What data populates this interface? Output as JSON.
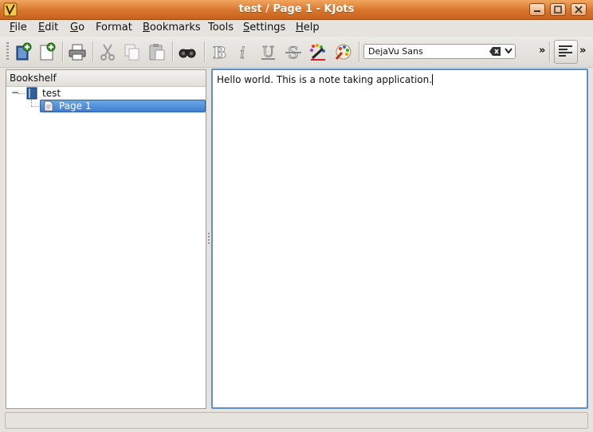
{
  "window": {
    "title": "test / Page 1 - KJots",
    "app_icon": "kjots-pencil-icon",
    "controls": [
      "minimize-icon",
      "maximize-icon",
      "close-icon"
    ]
  },
  "menubar": [
    {
      "label": "File",
      "mnemonic": "F",
      "rest": "ile"
    },
    {
      "label": "Edit",
      "mnemonic": "E",
      "rest": "dit"
    },
    {
      "label": "Go",
      "mnemonic": "G",
      "rest": "o"
    },
    {
      "label": "Format",
      "mnemonic": "",
      "rest": "Format"
    },
    {
      "label": "Bookmarks",
      "mnemonic": "B",
      "rest": "ookmarks"
    },
    {
      "label": "Tools",
      "mnemonic": "",
      "rest": "Tools"
    },
    {
      "label": "Settings",
      "mnemonic": "S",
      "rest": "ettings"
    },
    {
      "label": "Help",
      "mnemonic": "H",
      "rest": "elp"
    }
  ],
  "toolbar": {
    "icons": [
      "new-book-icon",
      "new-page-icon",
      "print-icon",
      "cut-icon",
      "copy-icon",
      "paste-icon",
      "find-icon",
      "bold-icon",
      "italic-icon",
      "underline-icon",
      "strikethrough-icon",
      "text-color-icon",
      "highlight-color-icon",
      "align-left-icon"
    ],
    "font_name": "DejaVu Sans",
    "overflow_label": "»"
  },
  "bookshelf": {
    "header": "Bookshelf",
    "book": {
      "label": "test",
      "expander": "−"
    },
    "page": {
      "label": "Page 1"
    }
  },
  "editor": {
    "text": "Hello world. This is a note taking application."
  },
  "colors": {
    "titlebar": "#d8742b",
    "selection": "#3f7fcf",
    "editor_focus_border": "#5e8fc9"
  }
}
